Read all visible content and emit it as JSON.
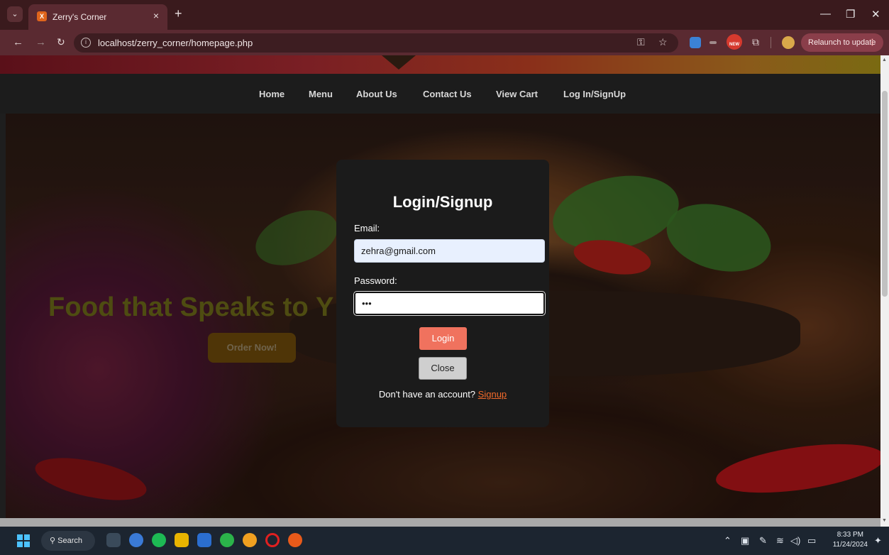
{
  "browser": {
    "tab_title": "Zerry's Corner",
    "tab_close": "×",
    "new_tab": "+",
    "url": "localhost/zerry_corner/homepage.php",
    "relaunch_label": "Relaunch to update",
    "relaunch_menu": "⋮",
    "ext_badge": "NEW"
  },
  "nav": {
    "items": [
      "Home",
      "Menu",
      "About Us",
      "Contact Us",
      "View Cart",
      "Log In/SignUp"
    ]
  },
  "hero": {
    "title": "Food that Speaks to Y",
    "order_button": "Order Now!"
  },
  "modal": {
    "title": "Login/Signup",
    "email_label": "Email:",
    "email_value": "zehra@gmail.com",
    "password_label": "Password:",
    "password_value": "•••",
    "login_button": "Login",
    "close_button": "Close",
    "signup_prompt": "Don't have an account?",
    "signup_link": "Signup"
  },
  "taskbar": {
    "search_label": "Search",
    "time": "8:33 PM",
    "date": "11/24/2024"
  },
  "colors": {
    "login_button": "#f0725e",
    "signup_link": "#f26a2a",
    "hero_title": "#6d6a18",
    "order_button": "#6e4a0a"
  }
}
